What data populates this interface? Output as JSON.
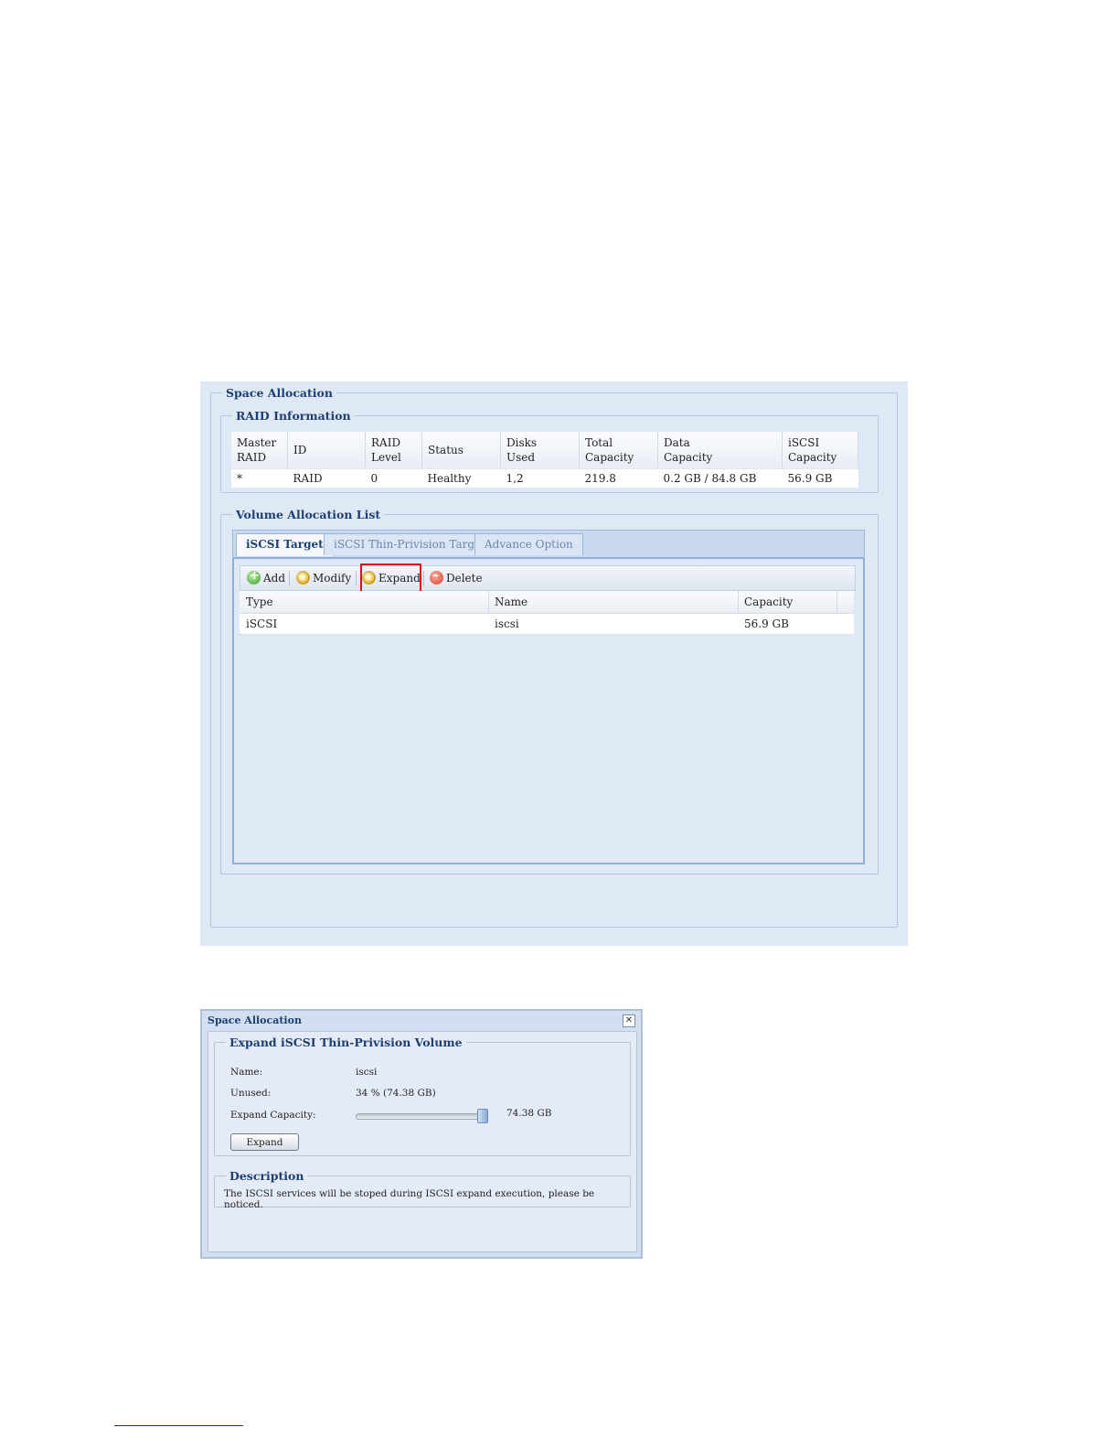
{
  "space_allocation": {
    "title": "Space Allocation",
    "raid_info": {
      "title": "RAID Information",
      "columns": [
        [
          "Master",
          "RAID"
        ],
        [
          "ID",
          ""
        ],
        [
          "RAID",
          "Level"
        ],
        [
          "Status",
          ""
        ],
        [
          "Disks",
          "Used"
        ],
        [
          "Total",
          "Capacity"
        ],
        [
          "Data",
          "Capacity"
        ],
        [
          "iSCSI",
          "Capacity"
        ]
      ],
      "row": [
        "*",
        "RAID",
        "0",
        "Healthy",
        "1,2",
        "219.8",
        "0.2 GB / 84.8 GB",
        "56.9 GB"
      ]
    },
    "volume_list": {
      "title": "Volume Allocation List",
      "tabs": [
        "iSCSI Target",
        "iSCSI Thin-Privision Target",
        "Advance Option"
      ],
      "active_tab": 0,
      "toolbar": {
        "add": "Add",
        "modify": "Modify",
        "expand": "Expand",
        "delete": "Delete"
      },
      "grid_columns": [
        "Type",
        "Name",
        "Capacity"
      ],
      "rows": [
        {
          "type": "iSCSI",
          "name": "iscsi",
          "capacity": "56.9 GB"
        }
      ]
    }
  },
  "dialog": {
    "title": "Space Allocation",
    "close_icon": "close-icon",
    "expand_section": {
      "title": "Expand iSCSI Thin-Privision Volume",
      "name_label": "Name:",
      "name_value": "iscsi",
      "unused_label": "Unused:",
      "unused_value": "34 % (74.38 GB)",
      "expand_capacity_label": "Expand Capacity:",
      "expand_capacity_value": "74.38 GB",
      "slider_level": 1.0,
      "button": "Expand"
    },
    "description": {
      "title": "Description",
      "text": "The ISCSI services will be stoped during ISCSI expand execution, please be noticed."
    }
  },
  "colors": {
    "panel_bg": "#dfe8f5",
    "heading": "#1d3f72",
    "highlight": "#d4141b"
  }
}
